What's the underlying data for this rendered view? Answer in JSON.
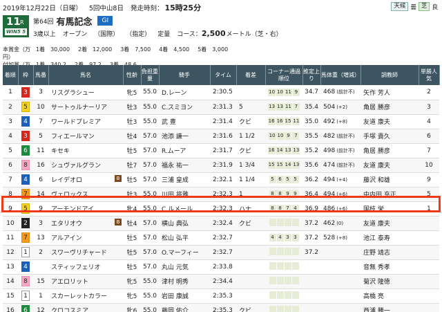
{
  "header": {
    "date": "2019年12月22日（日曜）",
    "meeting": "5回中山8日",
    "post_time_label": "発走時刻：",
    "post_time": "15時25分",
    "weather_label": "天候",
    "weather": "曇",
    "track_label": "芝",
    "track": "良"
  },
  "race": {
    "number": "11",
    "r": "R",
    "win5": "WIN5 5",
    "edition": "第64回",
    "name": "有馬記念",
    "grade": "GI",
    "conditions": [
      "3歳以上",
      "オープン",
      "（国際）",
      "（指定）",
      "定量"
    ],
    "course_label": "コース：",
    "distance": "2,500",
    "distance_unit": "メートル（芝・右）"
  },
  "prize": {
    "rows": [
      {
        "label": "本賞金（万円）",
        "cells": [
          "1着　30,000",
          "2着　12,000",
          "3着　7,500",
          "4着　4,500",
          "5着　3,000"
        ]
      },
      {
        "label": "付加賞（万円）",
        "cells": [
          "1着　340.2",
          "2着　97.2",
          "3着　48.6"
        ]
      }
    ]
  },
  "table": {
    "headers": [
      "着順",
      "枠",
      "馬番",
      "馬名",
      "性齢",
      "負担重量",
      "騎手",
      "タイム",
      "着差",
      "コーナー通過順位",
      "推定上り",
      "馬体重（増減）",
      "調教師",
      "単勝人気"
    ],
    "rows": [
      {
        "rank": "1",
        "waku": "3",
        "num": "3",
        "horse": "リスグラシュー",
        "blinker": "",
        "sexage": "牝5",
        "weight": "55.0",
        "jockey": "D.レーン",
        "time": "2:30.5",
        "margin": "",
        "corners": [
          "10",
          "10",
          "11",
          "9"
        ],
        "last3f": "34.7",
        "body": "468",
        "diff": "(前計不)",
        "trainer": "矢作 芳人",
        "pop": "2"
      },
      {
        "rank": "2",
        "waku": "5",
        "num": "10",
        "horse": "サートゥルナーリア",
        "blinker": "",
        "sexage": "牡3",
        "weight": "55.0",
        "jockey": "C.スミヨン",
        "time": "2:31.3",
        "margin": "5",
        "corners": [
          "13",
          "13",
          "11",
          "7"
        ],
        "last3f": "35.4",
        "body": "504",
        "diff": "(+2)",
        "trainer": "角居 勝彦",
        "pop": "3"
      },
      {
        "rank": "3",
        "waku": "4",
        "num": "7",
        "horse": "ワールドプレミア",
        "blinker": "",
        "sexage": "牡3",
        "weight": "55.0",
        "jockey": "武 豊",
        "time": "2:31.4",
        "margin": "クビ",
        "corners": [
          "16",
          "16",
          "15",
          "11"
        ],
        "last3f": "35.0",
        "body": "492",
        "diff": "(+8)",
        "trainer": "友道 康夫",
        "pop": "4"
      },
      {
        "rank": "4",
        "waku": "3",
        "num": "5",
        "horse": "フィエールマン",
        "blinker": "",
        "sexage": "牡4",
        "weight": "57.0",
        "jockey": "池添 謙一",
        "time": "2:31.6",
        "margin": "1 1/2",
        "corners": [
          "10",
          "10",
          "9",
          "7"
        ],
        "last3f": "35.5",
        "body": "482",
        "diff": "(前計不)",
        "trainer": "手塚 貴久",
        "pop": "6"
      },
      {
        "rank": "5",
        "waku": "6",
        "num": "11",
        "horse": "キセキ",
        "blinker": "",
        "sexage": "牡5",
        "weight": "57.0",
        "jockey": "R.ムーア",
        "time": "2:31.7",
        "margin": "クビ",
        "corners": [
          "16",
          "14",
          "13",
          "13"
        ],
        "last3f": "35.2",
        "body": "498",
        "diff": "(前計不)",
        "trainer": "角居 勝彦",
        "pop": "7"
      },
      {
        "rank": "6",
        "waku": "8",
        "num": "16",
        "horse": "シュヴァルグラン",
        "blinker": "",
        "sexage": "牡7",
        "weight": "57.0",
        "jockey": "福永 祐一",
        "time": "2:31.9",
        "margin": "1 3/4",
        "corners": [
          "15",
          "15",
          "14",
          "13"
        ],
        "last3f": "35.6",
        "body": "474",
        "diff": "(前計不)",
        "trainer": "友道 康夫",
        "pop": "10"
      },
      {
        "rank": "7",
        "waku": "4",
        "num": "6",
        "horse": "レイデオロ",
        "blinker": "B",
        "sexage": "牡5",
        "weight": "57.0",
        "jockey": "三浦 皇成",
        "time": "2:32.1",
        "margin": "1 1/4",
        "corners": [
          "5",
          "6",
          "5",
          "5"
        ],
        "last3f": "36.2",
        "body": "494",
        "diff": "(+4)",
        "trainer": "藤沢 和雄",
        "pop": "9"
      },
      {
        "rank": "8",
        "waku": "7",
        "num": "14",
        "horse": "ヴェロックス",
        "blinker": "",
        "sexage": "牡3",
        "weight": "55.0",
        "jockey": "川田 将雅",
        "time": "2:32.3",
        "margin": "1",
        "corners": [
          "8",
          "8",
          "9",
          "9"
        ],
        "last3f": "36.4",
        "body": "494",
        "diff": "(+6)",
        "trainer": "中内田 充正",
        "pop": "5"
      },
      {
        "rank": "9",
        "waku": "5",
        "num": "9",
        "horse": "アーモンドアイ",
        "blinker": "",
        "sexage": "牝4",
        "weight": "55.0",
        "jockey": "C.ルメール",
        "time": "2:32.3",
        "margin": "ハナ",
        "corners": [
          "8",
          "8",
          "7",
          "4"
        ],
        "last3f": "36.9",
        "body": "486",
        "diff": "(+6)",
        "trainer": "国枝 栄",
        "pop": "1"
      },
      {
        "rank": "10",
        "waku": "2",
        "num": "3",
        "horse": "エタリオウ",
        "blinker": "B",
        "sexage": "牡4",
        "weight": "57.0",
        "jockey": "横山 典弘",
        "time": "2:32.4",
        "margin": "クビ",
        "corners": [
          "",
          "",
          "",
          ""
        ],
        "last3f": "37.2",
        "body": "462",
        "diff": "(0)",
        "trainer": "友道 康夫",
        "pop": ""
      },
      {
        "rank": "11",
        "waku": "7",
        "num": "13",
        "horse": "アルアイン",
        "blinker": "",
        "sexage": "牡5",
        "weight": "57.0",
        "jockey": "松山 弘平",
        "time": "2:32.7",
        "margin": "",
        "corners": [
          "4",
          "4",
          "3",
          "3"
        ],
        "last3f": "37.2",
        "body": "528",
        "diff": "(+8)",
        "trainer": "池江 泰寿",
        "pop": ""
      },
      {
        "rank": "12",
        "waku": "1",
        "num": "2",
        "horse": "スワーヴリチャード",
        "blinker": "",
        "sexage": "牡5",
        "weight": "57.0",
        "jockey": "O.マーフィー",
        "time": "2:32.7",
        "margin": "",
        "corners": [
          "",
          "",
          "",
          ""
        ],
        "last3f": "37.2",
        "body": "",
        "diff": "",
        "trainer": "庄野 靖志",
        "pop": ""
      },
      {
        "rank": "13",
        "waku": "4",
        "num": "",
        "horse": "スティッフェリオ",
        "blinker": "",
        "sexage": "牡5",
        "weight": "57.0",
        "jockey": "丸山 元気",
        "time": "2:33.8",
        "margin": "",
        "corners": [
          "",
          "",
          "",
          ""
        ],
        "last3f": "",
        "body": "",
        "diff": "",
        "trainer": "音無 秀孝",
        "pop": ""
      },
      {
        "rank": "14",
        "waku": "8",
        "num": "15",
        "horse": "アエロリット",
        "blinker": "",
        "sexage": "牝5",
        "weight": "55.0",
        "jockey": "津村 明秀",
        "time": "2:34.4",
        "margin": "",
        "corners": [
          "",
          "",
          "",
          ""
        ],
        "last3f": "",
        "body": "",
        "diff": "",
        "trainer": "菊沢 隆徳",
        "pop": ""
      },
      {
        "rank": "15",
        "waku": "1",
        "num": "1",
        "horse": "スカーレットカラー",
        "blinker": "",
        "sexage": "牝5",
        "weight": "55.0",
        "jockey": "岩田 康誠",
        "time": "2:35.3",
        "margin": "",
        "corners": [
          "",
          "",
          "",
          ""
        ],
        "last3f": "",
        "body": "",
        "diff": "",
        "trainer": "高橋 亮",
        "pop": ""
      },
      {
        "rank": "16",
        "waku": "6",
        "num": "12",
        "horse": "クロコスミア",
        "blinker": "",
        "sexage": "牝6",
        "weight": "55.0",
        "jockey": "藤岡 佑介",
        "time": "2:35.3",
        "margin": "クビ",
        "corners": [
          "",
          "",
          "",
          ""
        ],
        "last3f": "",
        "body": "",
        "diff": "",
        "trainer": "西浦 勝一",
        "pop": ""
      }
    ]
  },
  "highlight_color": "#f03a17"
}
